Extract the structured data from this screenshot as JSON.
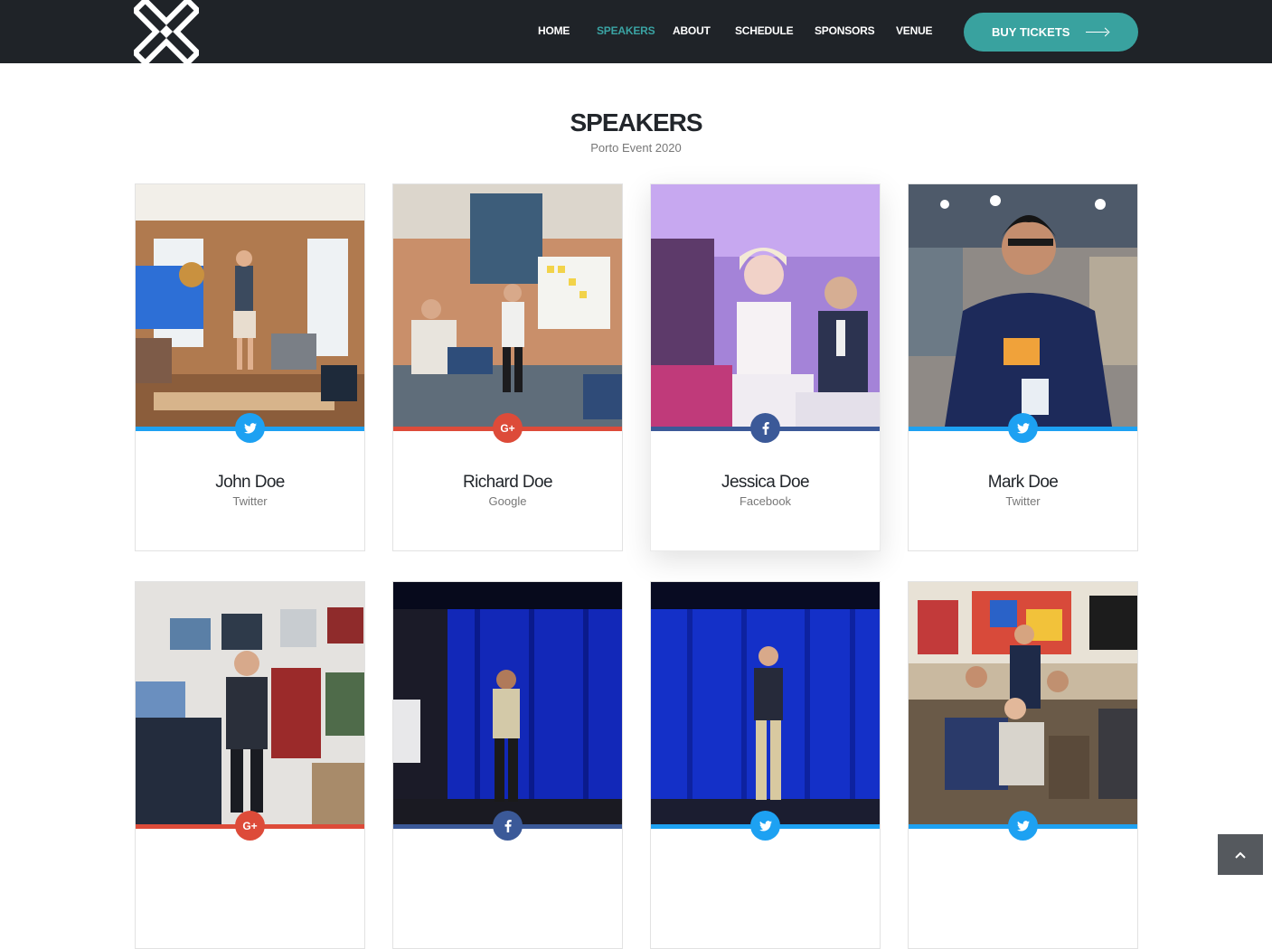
{
  "header": {
    "logo_name": "x-cross-logo",
    "nav": [
      {
        "label": "HOME",
        "active": false
      },
      {
        "label": "SPEAKERS",
        "active": true
      },
      {
        "label": "ABOUT",
        "active": false
      },
      {
        "label": "SCHEDULE",
        "active": false
      },
      {
        "label": "SPONSORS",
        "active": false
      },
      {
        "label": "VENUE",
        "active": false
      }
    ],
    "cta_label": "BUY TICKETS",
    "cta_icon": "arrow-right-icon"
  },
  "section": {
    "title": "SPEAKERS",
    "subtitle": "Porto Event 2020"
  },
  "colors": {
    "header_bg": "#1f2328",
    "accent": "#39a29f",
    "twitter": "#1da1f2",
    "google": "#dd4b39",
    "facebook": "#3b5998"
  },
  "speakers": [
    {
      "name": "John Doe",
      "company": "Twitter",
      "social": "twitter",
      "icon": "twitter-icon"
    },
    {
      "name": "Richard Doe",
      "company": "Google",
      "social": "google",
      "icon": "google-plus-icon"
    },
    {
      "name": "Jessica Doe",
      "company": "Facebook",
      "social": "facebook",
      "icon": "facebook-icon"
    },
    {
      "name": "Mark Doe",
      "company": "Twitter",
      "social": "twitter",
      "icon": "twitter-icon"
    },
    {
      "name": "",
      "company": "",
      "social": "google",
      "icon": "google-plus-icon"
    },
    {
      "name": "",
      "company": "",
      "social": "facebook",
      "icon": "facebook-icon"
    },
    {
      "name": "",
      "company": "",
      "social": "twitter",
      "icon": "twitter-icon"
    },
    {
      "name": "",
      "company": "",
      "social": "twitter",
      "icon": "twitter-icon"
    }
  ],
  "scroll_top_icon": "chevron-up-icon"
}
